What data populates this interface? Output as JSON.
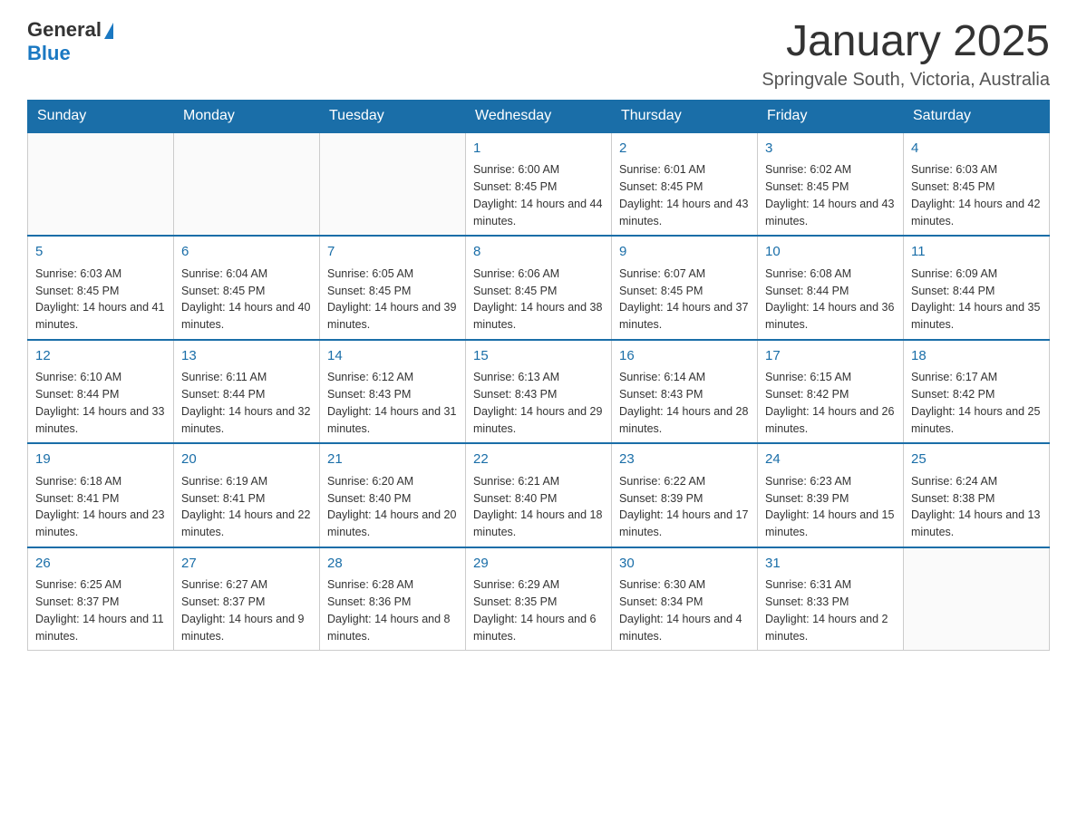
{
  "header": {
    "logo_general": "General",
    "logo_blue": "Blue",
    "title": "January 2025",
    "subtitle": "Springvale South, Victoria, Australia"
  },
  "calendar": {
    "days_of_week": [
      "Sunday",
      "Monday",
      "Tuesday",
      "Wednesday",
      "Thursday",
      "Friday",
      "Saturday"
    ],
    "weeks": [
      [
        {
          "day": "",
          "info": ""
        },
        {
          "day": "",
          "info": ""
        },
        {
          "day": "",
          "info": ""
        },
        {
          "day": "1",
          "info": "Sunrise: 6:00 AM\nSunset: 8:45 PM\nDaylight: 14 hours and 44 minutes."
        },
        {
          "day": "2",
          "info": "Sunrise: 6:01 AM\nSunset: 8:45 PM\nDaylight: 14 hours and 43 minutes."
        },
        {
          "day": "3",
          "info": "Sunrise: 6:02 AM\nSunset: 8:45 PM\nDaylight: 14 hours and 43 minutes."
        },
        {
          "day": "4",
          "info": "Sunrise: 6:03 AM\nSunset: 8:45 PM\nDaylight: 14 hours and 42 minutes."
        }
      ],
      [
        {
          "day": "5",
          "info": "Sunrise: 6:03 AM\nSunset: 8:45 PM\nDaylight: 14 hours and 41 minutes."
        },
        {
          "day": "6",
          "info": "Sunrise: 6:04 AM\nSunset: 8:45 PM\nDaylight: 14 hours and 40 minutes."
        },
        {
          "day": "7",
          "info": "Sunrise: 6:05 AM\nSunset: 8:45 PM\nDaylight: 14 hours and 39 minutes."
        },
        {
          "day": "8",
          "info": "Sunrise: 6:06 AM\nSunset: 8:45 PM\nDaylight: 14 hours and 38 minutes."
        },
        {
          "day": "9",
          "info": "Sunrise: 6:07 AM\nSunset: 8:45 PM\nDaylight: 14 hours and 37 minutes."
        },
        {
          "day": "10",
          "info": "Sunrise: 6:08 AM\nSunset: 8:44 PM\nDaylight: 14 hours and 36 minutes."
        },
        {
          "day": "11",
          "info": "Sunrise: 6:09 AM\nSunset: 8:44 PM\nDaylight: 14 hours and 35 minutes."
        }
      ],
      [
        {
          "day": "12",
          "info": "Sunrise: 6:10 AM\nSunset: 8:44 PM\nDaylight: 14 hours and 33 minutes."
        },
        {
          "day": "13",
          "info": "Sunrise: 6:11 AM\nSunset: 8:44 PM\nDaylight: 14 hours and 32 minutes."
        },
        {
          "day": "14",
          "info": "Sunrise: 6:12 AM\nSunset: 8:43 PM\nDaylight: 14 hours and 31 minutes."
        },
        {
          "day": "15",
          "info": "Sunrise: 6:13 AM\nSunset: 8:43 PM\nDaylight: 14 hours and 29 minutes."
        },
        {
          "day": "16",
          "info": "Sunrise: 6:14 AM\nSunset: 8:43 PM\nDaylight: 14 hours and 28 minutes."
        },
        {
          "day": "17",
          "info": "Sunrise: 6:15 AM\nSunset: 8:42 PM\nDaylight: 14 hours and 26 minutes."
        },
        {
          "day": "18",
          "info": "Sunrise: 6:17 AM\nSunset: 8:42 PM\nDaylight: 14 hours and 25 minutes."
        }
      ],
      [
        {
          "day": "19",
          "info": "Sunrise: 6:18 AM\nSunset: 8:41 PM\nDaylight: 14 hours and 23 minutes."
        },
        {
          "day": "20",
          "info": "Sunrise: 6:19 AM\nSunset: 8:41 PM\nDaylight: 14 hours and 22 minutes."
        },
        {
          "day": "21",
          "info": "Sunrise: 6:20 AM\nSunset: 8:40 PM\nDaylight: 14 hours and 20 minutes."
        },
        {
          "day": "22",
          "info": "Sunrise: 6:21 AM\nSunset: 8:40 PM\nDaylight: 14 hours and 18 minutes."
        },
        {
          "day": "23",
          "info": "Sunrise: 6:22 AM\nSunset: 8:39 PM\nDaylight: 14 hours and 17 minutes."
        },
        {
          "day": "24",
          "info": "Sunrise: 6:23 AM\nSunset: 8:39 PM\nDaylight: 14 hours and 15 minutes."
        },
        {
          "day": "25",
          "info": "Sunrise: 6:24 AM\nSunset: 8:38 PM\nDaylight: 14 hours and 13 minutes."
        }
      ],
      [
        {
          "day": "26",
          "info": "Sunrise: 6:25 AM\nSunset: 8:37 PM\nDaylight: 14 hours and 11 minutes."
        },
        {
          "day": "27",
          "info": "Sunrise: 6:27 AM\nSunset: 8:37 PM\nDaylight: 14 hours and 9 minutes."
        },
        {
          "day": "28",
          "info": "Sunrise: 6:28 AM\nSunset: 8:36 PM\nDaylight: 14 hours and 8 minutes."
        },
        {
          "day": "29",
          "info": "Sunrise: 6:29 AM\nSunset: 8:35 PM\nDaylight: 14 hours and 6 minutes."
        },
        {
          "day": "30",
          "info": "Sunrise: 6:30 AM\nSunset: 8:34 PM\nDaylight: 14 hours and 4 minutes."
        },
        {
          "day": "31",
          "info": "Sunrise: 6:31 AM\nSunset: 8:33 PM\nDaylight: 14 hours and 2 minutes."
        },
        {
          "day": "",
          "info": ""
        }
      ]
    ]
  }
}
